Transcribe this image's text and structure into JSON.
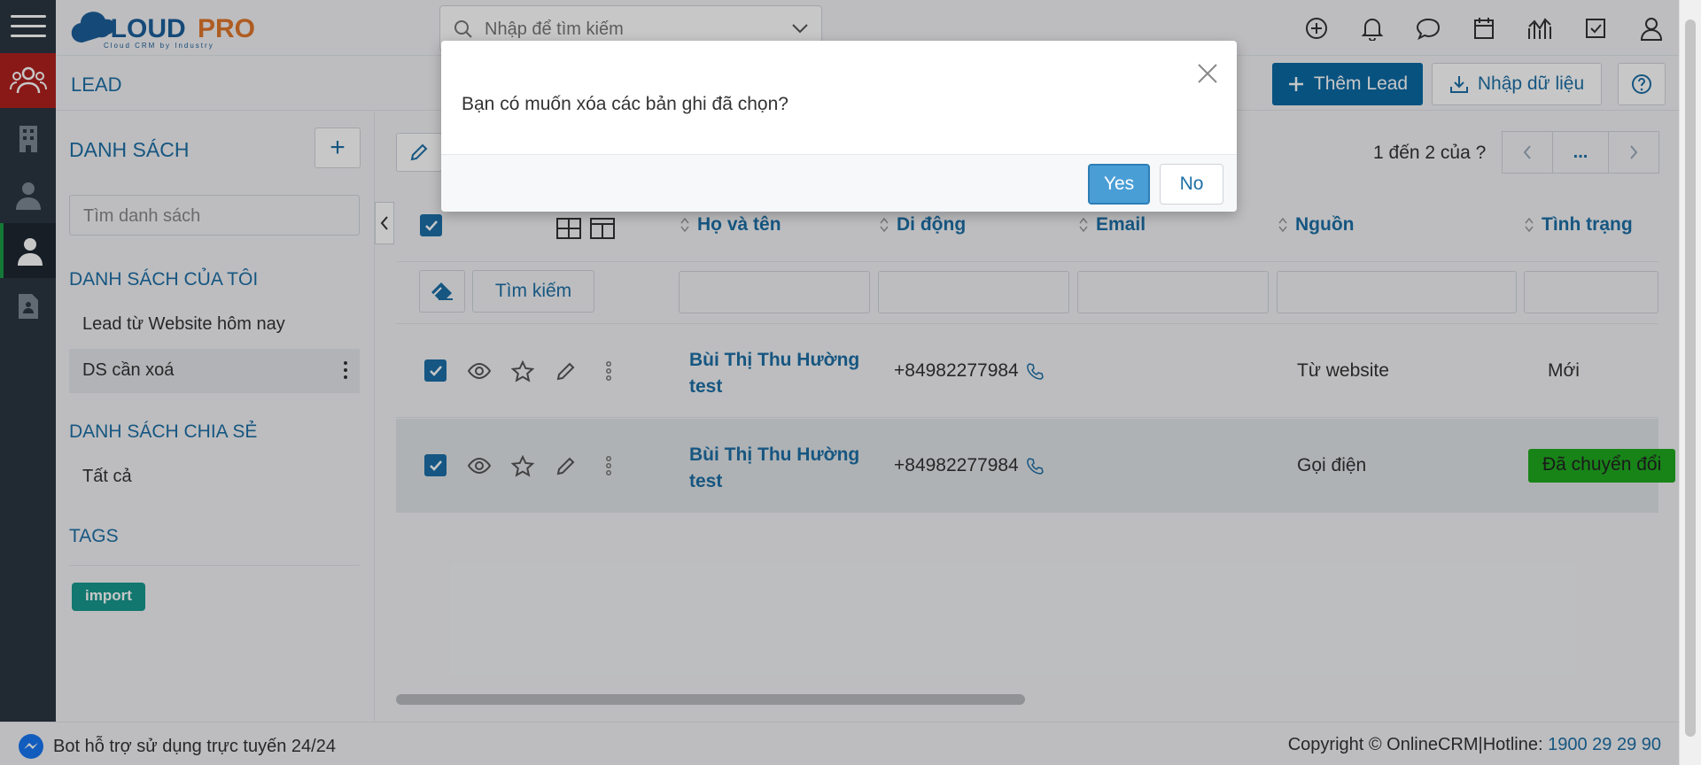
{
  "app": {
    "logo_text": "CLOUDPRO",
    "logo_tagline": "Cloud CRM by Industry"
  },
  "search": {
    "placeholder": "Nhập để tìm kiếm"
  },
  "page": {
    "title": "LEAD",
    "add_label": "Thêm Lead",
    "import_label": "Nhập dữ liệu"
  },
  "sidebar": {
    "title": "DANH SÁCH",
    "search_placeholder": "Tìm danh sách",
    "my_lists_heading": "DANH SÁCH CỦA TÔI",
    "my_lists": [
      "Lead từ Website hôm nay",
      "DS cần xoá"
    ],
    "shared_heading": "DANH SÁCH CHIA SẺ",
    "shared_lists": [
      "Tất cả"
    ],
    "tags_heading": "TAGS",
    "tags": [
      "import"
    ]
  },
  "pager": {
    "text": "1 đến 2 của",
    "unknown": "?",
    "more": "..."
  },
  "grid": {
    "columns": [
      "Họ và tên",
      "Di động",
      "Email",
      "Nguồn",
      "Tình trạng"
    ],
    "search_label": "Tìm kiếm",
    "rows": [
      {
        "name": "Bùi Thị Thu Hường test",
        "phone": "+84982277984",
        "email": "",
        "source": "Từ website",
        "status": "Mới"
      },
      {
        "name": "Bùi Thị Thu Hường test",
        "phone": "+84982277984",
        "email": "",
        "source": "Gọi điện",
        "status": "Đã chuyển đổi"
      }
    ]
  },
  "footer": {
    "bot": "Bot hỗ trợ sử dụng trực tuyến 24/24",
    "copyright": "Copyright © OnlineCRM|Hotline: ",
    "hotline": "1900 29 29 90"
  },
  "modal": {
    "message": "Bạn có muốn xóa các bản ghi đã chọn?",
    "yes": "Yes",
    "no": "No"
  },
  "colors": {
    "primary": "#0b6aa4",
    "link": "#1d6fa6",
    "rail": "#2b3541",
    "status_converted": "#1faa1f",
    "tag": "#17998f"
  }
}
